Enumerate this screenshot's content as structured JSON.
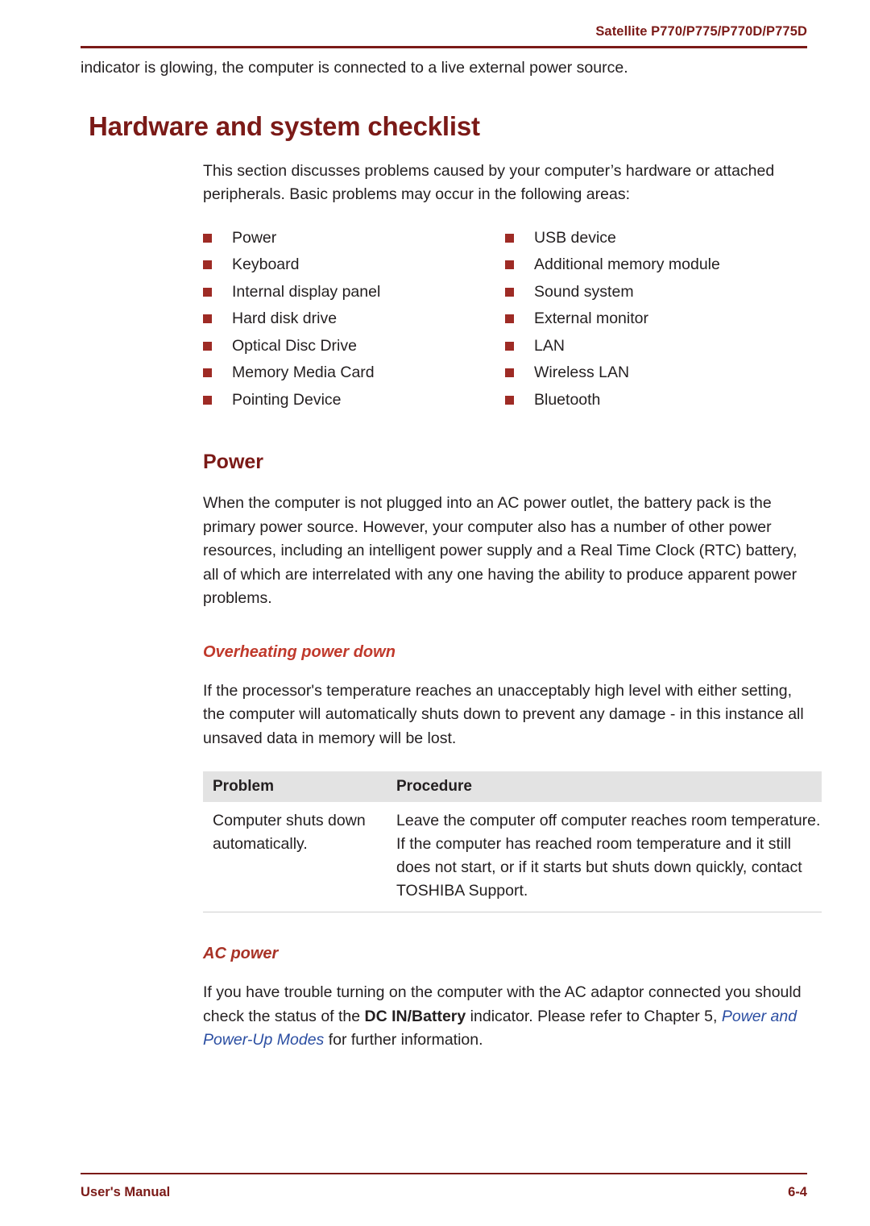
{
  "header": {
    "title": "Satellite P770/P775/P770D/P775D"
  },
  "intro": {
    "continued_paragraph": "indicator is glowing, the computer is connected to a live external power source."
  },
  "chapter": {
    "title": "Hardware and system checklist",
    "description": "This section discusses problems caused by your computer’s hardware or attached peripherals. Basic problems may occur in the following areas:"
  },
  "checklist": {
    "column_left": [
      "Power",
      "Keyboard",
      "Internal display panel",
      "Hard disk drive",
      "Optical Disc Drive",
      "Memory Media Card",
      "Pointing Device"
    ],
    "column_right": [
      "USB device",
      "Additional memory module",
      "Sound system",
      "External monitor",
      "LAN",
      "Wireless LAN",
      "Bluetooth"
    ]
  },
  "power_section": {
    "title": "Power",
    "paragraph": "When the computer is not plugged into an AC power outlet, the battery pack is the primary power source. However, your computer also has a number of other power resources, including an intelligent power supply and a Real Time Clock (RTC) battery, all of which are interrelated with any one having the ability to produce apparent power problems."
  },
  "overheating_section": {
    "title": "Overheating power down",
    "paragraph": "If the processor's temperature reaches an unacceptably high level with either setting, the computer will automatically shuts down to prevent any damage - in this instance all unsaved data in memory will be lost.",
    "table": {
      "headers": [
        "Problem",
        "Procedure"
      ],
      "rows": [
        {
          "problem": "Computer shuts down automatically.",
          "procedure": "Leave the computer off computer reaches room temperature. If the computer has reached room temperature and it still does not start, or if it starts but shuts down quickly, contact TOSHIBA Support."
        }
      ]
    }
  },
  "ac_power_section": {
    "title": "AC power",
    "text_part1": "If you have trouble turning on the computer with the AC adaptor connected you should check the status of the ",
    "bold_term": "DC IN/Battery",
    "text_part2": " indicator. Please refer to Chapter 5, ",
    "link_text": "Power and Power-Up Modes",
    "text_part3": " for further information."
  },
  "footer": {
    "left": "User's Manual",
    "right": "6-4"
  },
  "colors": {
    "brand_red": "#7b1a17",
    "heading_red": "#c0392b",
    "bullet_red": "#9e2b25",
    "link_blue": "#2b4ea2",
    "table_header_bg": "#e3e3e3"
  }
}
